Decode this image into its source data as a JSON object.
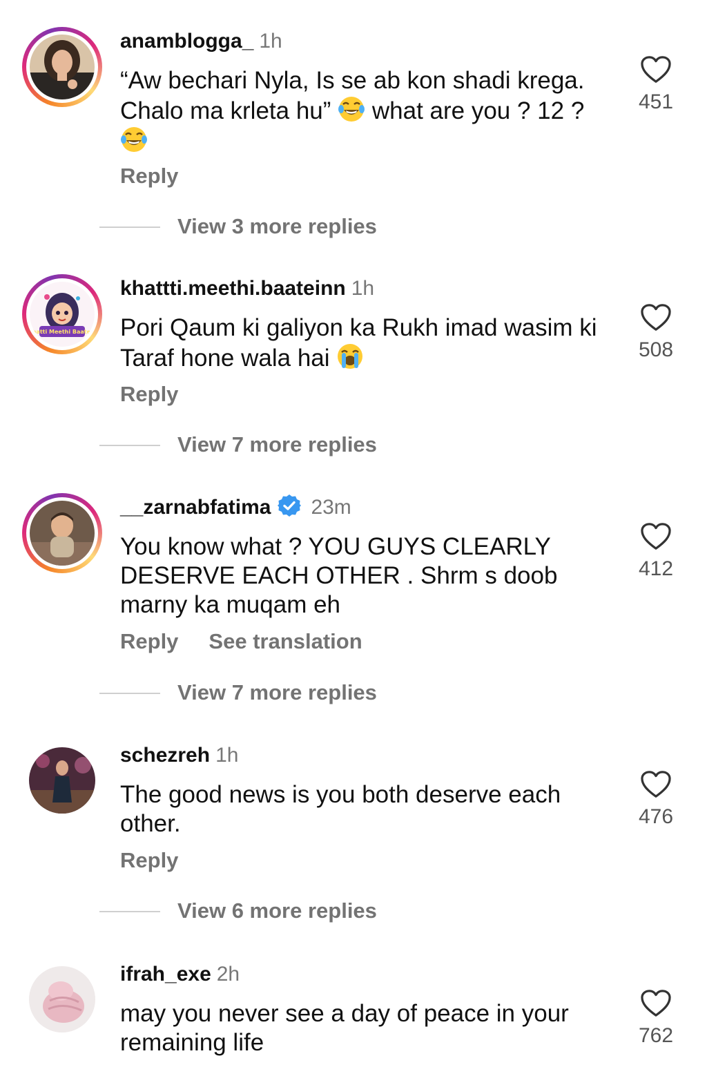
{
  "actions": {
    "reply_label": "Reply",
    "see_translation_label": "See translation"
  },
  "icons": {
    "heart": "heart-outline-icon",
    "verified": "verified-badge-icon",
    "laugh_emoji": "face-with-tears-of-joy",
    "cry_emoji": "loudly-crying-face"
  },
  "colors": {
    "secondary_text": "#737373",
    "verified_blue": "#3897f0",
    "story_ring_start": "#f58529",
    "story_ring_end": "#dd2a7b"
  },
  "comments": [
    {
      "username": "anamblogga_",
      "time": "1h",
      "text_1": "“Aw bechari Nyla, Is se ab kon shadi krega. Chalo ma krleta hu” ",
      "text_2": " what are you ? 12 ? ",
      "likes": "451",
      "view_replies": "View 3 more replies"
    },
    {
      "username": "khattti.meethi.baateinn",
      "time": "1h",
      "text_1": "Pori Qaum ki galiyon ka Rukh imad wasim ki Taraf hone wala hai ",
      "avatar_text": "Khatti Meethi Baatein",
      "likes": "508",
      "view_replies": "View 7 more replies"
    },
    {
      "username": "__zarnabfatima",
      "time": "23m",
      "text_1": "You know what ? YOU GUYS CLEARLY DESERVE EACH OTHER . Shrm s doob marny ka muqam eh",
      "likes": "412",
      "view_replies": "View 7 more replies"
    },
    {
      "username": "schezreh",
      "time": "1h",
      "text_1": "The good news is you both deserve each other.",
      "likes": "476",
      "view_replies": "View 6 more replies"
    },
    {
      "username": "ifrah_exe",
      "time": "2h",
      "text_1": "may you never see a day of peace in your remaining life",
      "likes": "762"
    }
  ]
}
